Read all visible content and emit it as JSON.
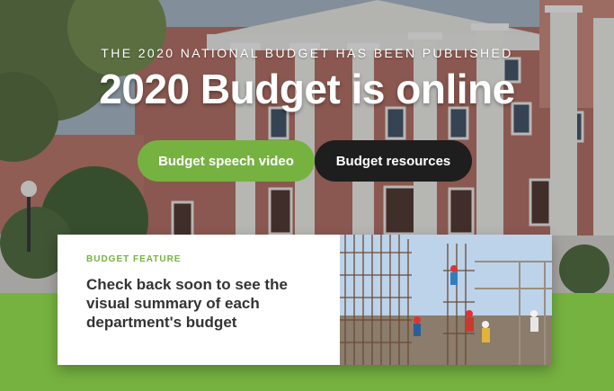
{
  "hero": {
    "eyebrow": "THE 2020 NATIONAL BUDGET HAS BEEN PUBLISHED",
    "headline": "2020 Budget is online",
    "buttons": {
      "speech_video": "Budget speech video",
      "resources": "Budget resources"
    }
  },
  "feature": {
    "tag": "BUDGET FEATURE",
    "title": "Check back soon to see the visual summary of each department's budget"
  },
  "colors": {
    "brand_green": "#76b240",
    "dark_button": "#1e1e1e",
    "white": "#ffffff",
    "text_dark": "#333333"
  }
}
